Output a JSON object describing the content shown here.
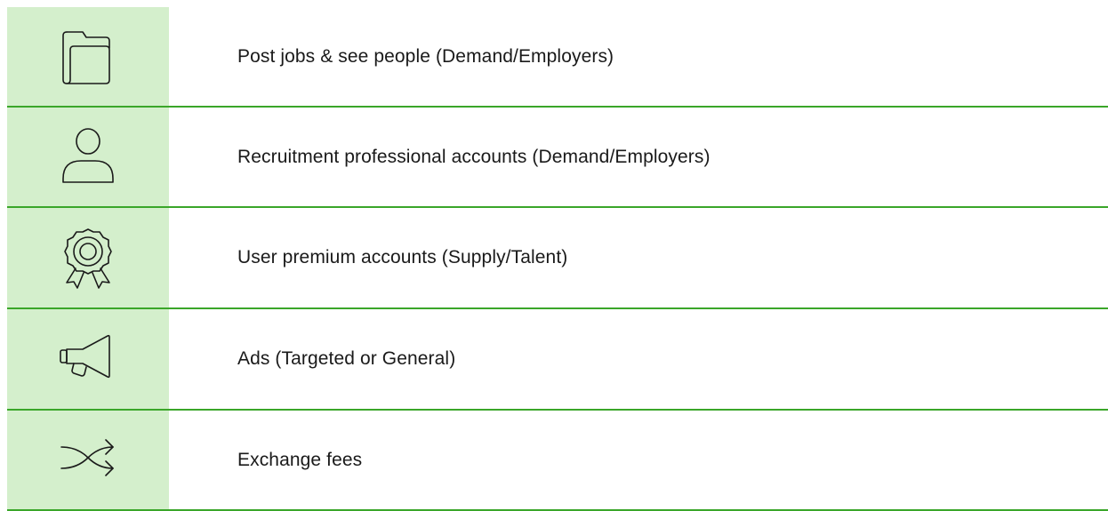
{
  "rows": [
    {
      "icon": "folder-icon",
      "label": "Post jobs & see people (Demand/Employers)"
    },
    {
      "icon": "user-icon",
      "label": "Recruitment professional accounts (Demand/Employers)"
    },
    {
      "icon": "award-ribbon-icon",
      "label": "User premium accounts (Supply/Talent)"
    },
    {
      "icon": "megaphone-icon",
      "label": "Ads (Targeted or General)"
    },
    {
      "icon": "shuffle-icon",
      "label": "Exchange fees"
    }
  ],
  "colors": {
    "accent_line": "#3aa629",
    "icon_column_bg": "#d4efcc",
    "text": "#1a1a1a"
  }
}
